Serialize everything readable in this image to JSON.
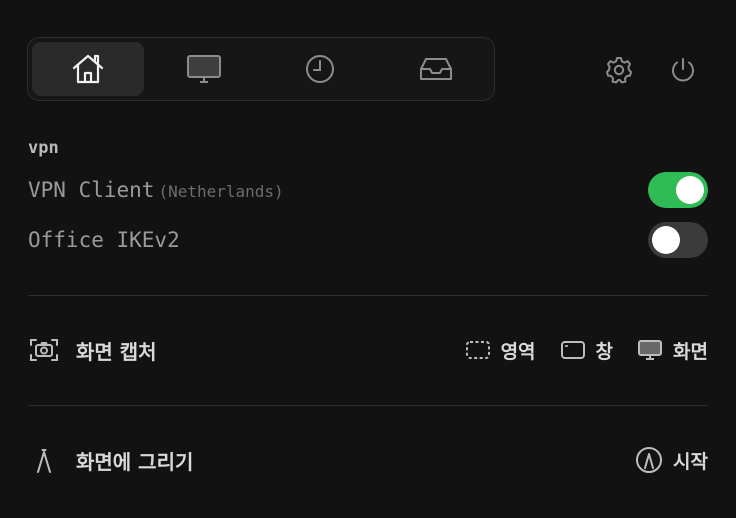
{
  "tabs": [
    {
      "name": "home",
      "icon": "home-icon",
      "active": true
    },
    {
      "name": "display",
      "icon": "monitor-icon",
      "active": false
    },
    {
      "name": "history",
      "icon": "clock-icon",
      "active": false
    },
    {
      "name": "inbox",
      "icon": "inbox-tray-icon",
      "active": false
    }
  ],
  "header_icons": [
    "gear-icon",
    "power-icon"
  ],
  "vpn": {
    "section_label": "vpn",
    "items": [
      {
        "name": "VPN Client",
        "detail": "(Netherlands)",
        "enabled": true
      },
      {
        "name": "Office IKEv2",
        "detail": "",
        "enabled": false
      }
    ]
  },
  "screen_capture": {
    "label": "화면 캡처",
    "icon": "camera-icon",
    "actions": [
      {
        "label": "영역",
        "icon": "selection-area-icon"
      },
      {
        "label": "창",
        "icon": "window-icon"
      },
      {
        "label": "화면",
        "icon": "monitor-icon"
      }
    ]
  },
  "draw_on_screen": {
    "label": "화면에 그리기",
    "icon": "pen-nib-icon",
    "action": {
      "label": "시작",
      "icon": "circle-pen-icon"
    }
  },
  "colors": {
    "background": "#121212",
    "toggle_on": "#2fbb55",
    "toggle_off": "#3a3a3a"
  }
}
